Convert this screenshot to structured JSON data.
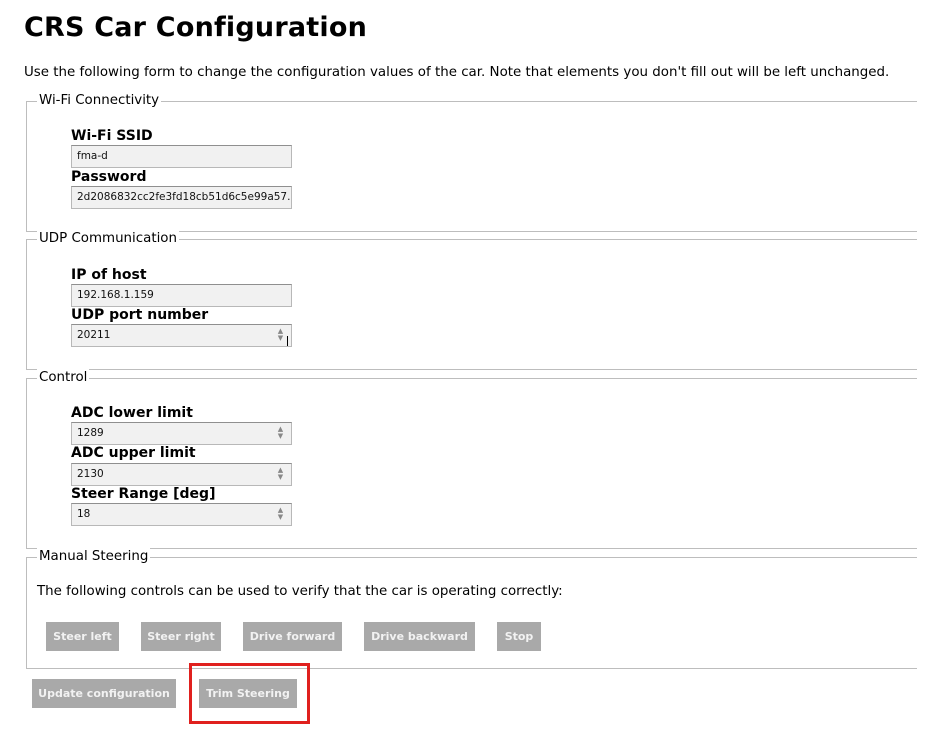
{
  "page": {
    "title": "CRS Car Configuration",
    "intro": "Use the following form to change the configuration values of the car. Note that elements you don't fill out will be left unchanged."
  },
  "wifi": {
    "legend": "Wi-Fi Connectivity",
    "ssid_label": "Wi-Fi SSID",
    "ssid_value": "fma-d",
    "password_label": "Password",
    "password_value": "2d2086832cc2fe3fd18cb51d6c5e99a57..."
  },
  "udp": {
    "legend": "UDP Communication",
    "ip_label": "IP of host",
    "ip_value": "192.168.1.159",
    "port_label": "UDP port number",
    "port_value": "20211"
  },
  "control": {
    "legend": "Control",
    "adc_lower_label": "ADC lower limit",
    "adc_lower_value": "1289",
    "adc_upper_label": "ADC upper limit",
    "adc_upper_value": "2130",
    "steer_range_label": "Steer Range [deg]",
    "steer_range_value": "18"
  },
  "manual": {
    "legend": "Manual Steering",
    "description": "The following controls can be used to verify that the car is operating correctly:",
    "buttons": {
      "steer_left": "Steer left",
      "steer_right": "Steer right",
      "drive_forward": "Drive forward",
      "drive_backward": "Drive backward",
      "stop": "Stop"
    }
  },
  "actions": {
    "update": "Update configuration",
    "trim": "Trim Steering"
  },
  "colors": {
    "button_bg": "#a9a9a9",
    "highlight": "#e0201e"
  }
}
